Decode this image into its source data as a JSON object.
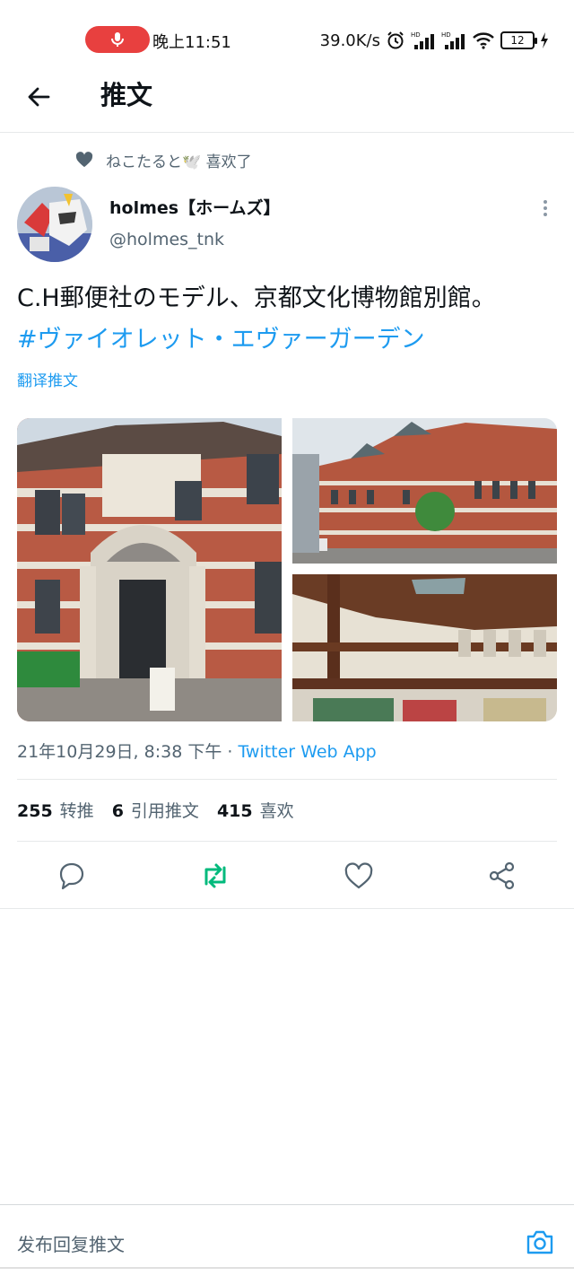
{
  "status_bar": {
    "time": "晚上11:51",
    "network_speed": "39.0K/s",
    "battery": "12"
  },
  "header": {
    "title": "推文"
  },
  "liked_by": {
    "text": "ねこたると🕊️ 喜欢了"
  },
  "author": {
    "name": "holmes【ホームズ】",
    "handle": "@holmes_tnk"
  },
  "tweet": {
    "text": "C.H郵便社のモデル、京都文化博物館別館。",
    "hashtag": "#ヴァイオレット・エヴァーガーデン",
    "translate_label": "翻译推文"
  },
  "meta": {
    "timestamp": "21年10月29日, 8:38 下午 · ",
    "source": "Twitter Web App"
  },
  "stats": {
    "retweets_count": "255",
    "retweets_label": "转推",
    "quotes_count": "6",
    "quotes_label": "引用推文",
    "likes_count": "415",
    "likes_label": "喜欢"
  },
  "reply": {
    "placeholder": "发布回复推文"
  },
  "colors": {
    "accent": "#1d9bf0",
    "retweet_active": "#00ba7c",
    "muted": "#536471"
  }
}
